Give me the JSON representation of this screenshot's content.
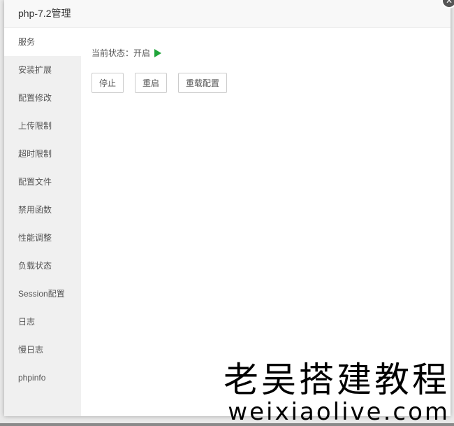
{
  "dialog": {
    "title": "php-7.2管理"
  },
  "sidebar": {
    "items": [
      {
        "label": "服务",
        "active": true
      },
      {
        "label": "安装扩展"
      },
      {
        "label": "配置修改"
      },
      {
        "label": "上传限制"
      },
      {
        "label": "超时限制"
      },
      {
        "label": "配置文件"
      },
      {
        "label": "禁用函数"
      },
      {
        "label": "性能调整"
      },
      {
        "label": "负载状态"
      },
      {
        "label": "Session配置"
      },
      {
        "label": "日志"
      },
      {
        "label": "慢日志"
      },
      {
        "label": "phpinfo"
      }
    ]
  },
  "service": {
    "status_label": "当前状态：",
    "status_value": "开启",
    "status_color": "#20a53a",
    "buttons": {
      "stop": "停止",
      "restart": "重启",
      "reload": "重载配置"
    }
  },
  "watermark": {
    "line1": "老吴搭建教程",
    "line2": "weixiaolive.com"
  }
}
